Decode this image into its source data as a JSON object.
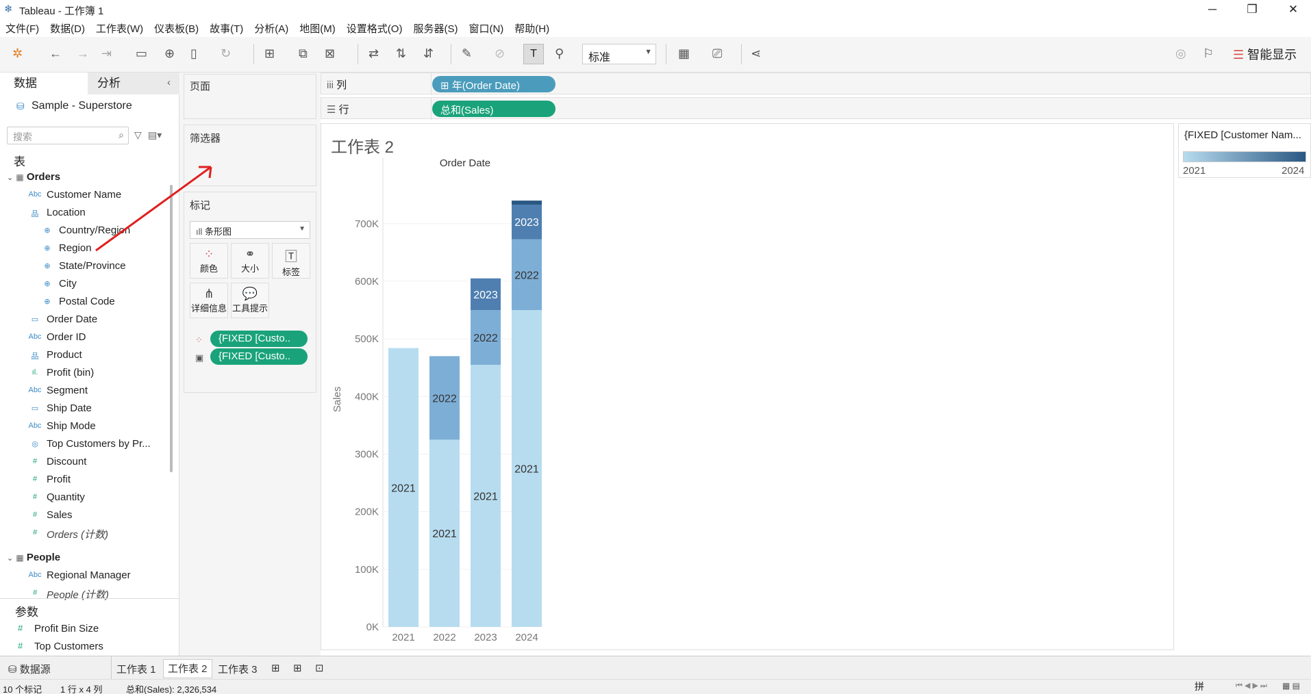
{
  "window": {
    "title": "Tableau - 工作簿 1"
  },
  "menu": [
    "文件(F)",
    "数据(D)",
    "工作表(W)",
    "仪表板(B)",
    "故事(T)",
    "分析(A)",
    "地图(M)",
    "设置格式(O)",
    "服务器(S)",
    "窗口(N)",
    "帮助(H)"
  ],
  "toolbar": {
    "fit_select": "标准",
    "smart_show": "智能显示"
  },
  "left_panel": {
    "tabs": {
      "data": "数据",
      "analysis": "分析"
    },
    "datasource": "Sample - Superstore",
    "search_placeholder": "搜索",
    "tables_header": "表",
    "tables": [
      {
        "name": "Orders",
        "fields": [
          {
            "icon": "Abc",
            "name": "Customer Name"
          },
          {
            "icon": "hier",
            "name": "Location"
          },
          {
            "icon": "globe",
            "name": "Country/Region"
          },
          {
            "icon": "globe",
            "name": "Region"
          },
          {
            "icon": "globe",
            "name": "State/Province"
          },
          {
            "icon": "globe",
            "name": "City"
          },
          {
            "icon": "globe",
            "name": "Postal Code"
          },
          {
            "icon": "date",
            "name": "Order Date"
          },
          {
            "icon": "Abc",
            "name": "Order ID"
          },
          {
            "icon": "hier",
            "name": "Product"
          },
          {
            "icon": "bin",
            "name": "Profit (bin)"
          },
          {
            "icon": "Abc",
            "name": "Segment"
          },
          {
            "icon": "date",
            "name": "Ship Date"
          },
          {
            "icon": "Abc",
            "name": "Ship Mode"
          },
          {
            "icon": "set",
            "name": "Top Customers by Pr..."
          },
          {
            "icon": "#",
            "name": "Discount"
          },
          {
            "icon": "#",
            "name": "Profit"
          },
          {
            "icon": "#",
            "name": "Quantity"
          },
          {
            "icon": "#",
            "name": "Sales"
          },
          {
            "icon": "#",
            "name": "Orders (计数)"
          }
        ]
      },
      {
        "name": "People",
        "fields": [
          {
            "icon": "Abc",
            "name": "Regional Manager"
          },
          {
            "icon": "#",
            "name": "People (计数)"
          }
        ]
      }
    ],
    "params_header": "参数",
    "params": [
      "Profit Bin Size",
      "Top Customers"
    ]
  },
  "cards": {
    "pages": "页面",
    "filters": "筛选器",
    "marks": "标记",
    "mark_type": "条形图",
    "mark_buttons": [
      "颜色",
      "大小",
      "标签",
      "详细信息",
      "工具提示"
    ],
    "mark_pills": [
      "{FIXED [Custo..",
      "{FIXED [Custo.."
    ]
  },
  "shelves": {
    "columns_label": "列",
    "columns_pill": "年(Order Date)",
    "rows_label": "行",
    "rows_pill": "总和(Sales)"
  },
  "worksheet_title": "工作表 2",
  "legend": {
    "title": "{FIXED [Customer Nam...",
    "min": "2021",
    "max": "2024",
    "color_low": "#b7dcef",
    "color_high": "#2a5783"
  },
  "sheet_tabs": {
    "datasource": "数据源",
    "sheets": [
      "工作表 1",
      "工作表 2",
      "工作表 3"
    ]
  },
  "status": {
    "marks": "10 个标记",
    "rows_cols": "1 行 x 4 列",
    "sum": "总和(Sales): 2,326,534"
  },
  "chart_data": {
    "type": "bar",
    "title": "Order Date",
    "ylabel": "Sales",
    "ylim": [
      0,
      790000
    ],
    "yticks": [
      "0K",
      "100K",
      "200K",
      "300K",
      "400K",
      "500K",
      "600K",
      "700K"
    ],
    "categories": [
      "2021",
      "2022",
      "2023",
      "2024"
    ],
    "series": [
      {
        "name": "2021",
        "color": "#b7dcef",
        "values": [
          484000,
          325000,
          455000,
          550000
        ]
      },
      {
        "name": "2022",
        "color": "#7daed6",
        "values": [
          0,
          145000,
          95000,
          123000
        ]
      },
      {
        "name": "2023",
        "color": "#4f7fb0",
        "values": [
          0,
          0,
          55000,
          60000
        ]
      },
      {
        "name": "2024",
        "color": "#2a5783",
        "values": [
          0,
          0,
          0,
          7000
        ]
      }
    ]
  }
}
